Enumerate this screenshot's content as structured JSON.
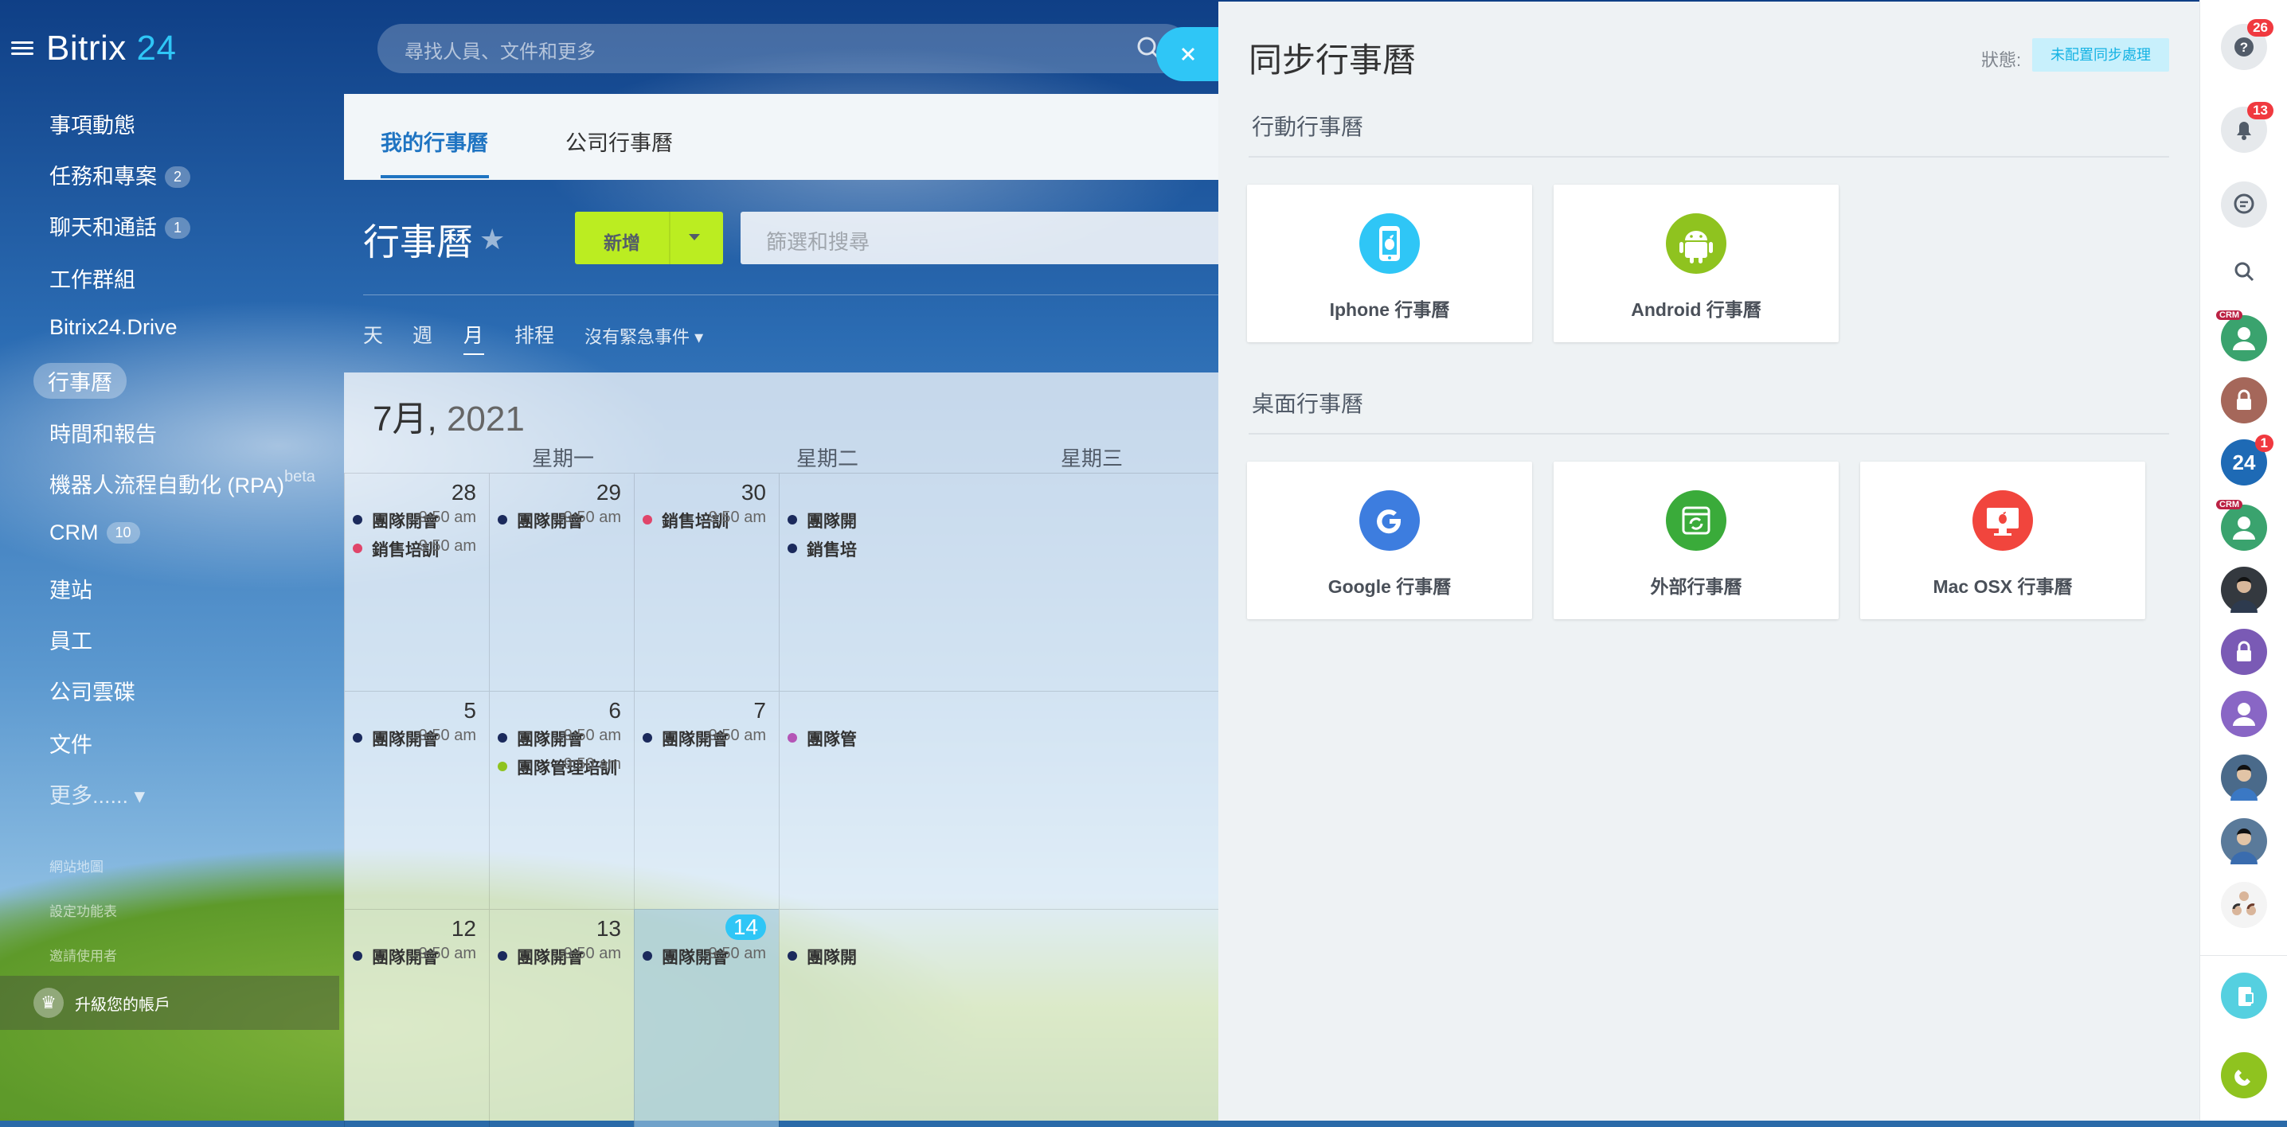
{
  "sidebar": {
    "logo_text": "Bitrix",
    "logo_num": "24",
    "items": [
      {
        "label": "事項動態"
      },
      {
        "label": "任務和專案",
        "badge": "2"
      },
      {
        "label": "聊天和通話",
        "badge": "1"
      },
      {
        "label": "工作群組"
      },
      {
        "label": "Bitrix24.Drive"
      },
      {
        "label": "行事曆",
        "active": true
      },
      {
        "label": "時間和報告"
      },
      {
        "label": "機器人流程自動化 (RPA)",
        "sup": "beta"
      },
      {
        "label": "CRM",
        "badge": "10"
      },
      {
        "label": "建站"
      },
      {
        "label": "員工"
      },
      {
        "label": "公司雲碟"
      },
      {
        "label": "文件"
      },
      {
        "label": "更多...... ▾"
      }
    ],
    "small_items": [
      {
        "label": "網站地圖"
      },
      {
        "label": "設定功能表"
      },
      {
        "label": "邀請使用者"
      }
    ],
    "upgrade_label": "升級您的帳戶"
  },
  "topbar": {
    "search_placeholder": "尋找人員、文件和更多"
  },
  "calendar": {
    "tabs": [
      "我的行事曆",
      "公司行事曆"
    ],
    "title": "行事曆",
    "add_label": "新增",
    "filter_placeholder": "篩選和搜尋",
    "views": [
      "天",
      "週",
      "月",
      "排程",
      "沒有緊急事件 ▾"
    ],
    "month_label": "7月,",
    "year_label": "2021",
    "weekdays": [
      "星期一",
      "星期二",
      "星期三"
    ],
    "weeks": [
      {
        "days": [
          {
            "num": "28",
            "events": [
              {
                "name": "團隊開會",
                "time": "9:50 am",
                "color": "#1b2a5c"
              },
              {
                "name": "銷售培訓",
                "time": "9:50 am",
                "color": "#e0456a"
              }
            ]
          },
          {
            "num": "29",
            "events": [
              {
                "name": "團隊開會",
                "time": "9:50 am",
                "color": "#1b2a5c"
              }
            ]
          },
          {
            "num": "30",
            "events": [
              {
                "name": "銷售培訓",
                "time": "9:50 am",
                "color": "#e0456a"
              }
            ]
          },
          {
            "num": "",
            "events": [
              {
                "name": "團隊開",
                "time": "",
                "color": "#1b2a5c"
              },
              {
                "name": "銷售培",
                "time": "",
                "color": "#1b2a5c"
              }
            ]
          }
        ]
      },
      {
        "days": [
          {
            "num": "5",
            "events": [
              {
                "name": "團隊開會",
                "time": "9:50 am",
                "color": "#1b2a5c"
              }
            ]
          },
          {
            "num": "6",
            "events": [
              {
                "name": "團隊開會",
                "time": "9:50 am",
                "color": "#1b2a5c"
              },
              {
                "name": "團隊管理培訓",
                "time": "9:50 am",
                "color": "#8fc31f"
              }
            ]
          },
          {
            "num": "7",
            "events": [
              {
                "name": "團隊開會",
                "time": "9:50 am",
                "color": "#1b2a5c"
              }
            ]
          },
          {
            "num": "",
            "events": [
              {
                "name": "團隊管",
                "time": "",
                "color": "#b455b6"
              }
            ]
          }
        ]
      },
      {
        "days": [
          {
            "num": "12",
            "events": [
              {
                "name": "團隊開會",
                "time": "9:50 am",
                "color": "#1b2a5c"
              }
            ]
          },
          {
            "num": "13",
            "events": [
              {
                "name": "團隊開會",
                "time": "9:50 am",
                "color": "#1b2a5c"
              }
            ]
          },
          {
            "num": "14",
            "today": true,
            "events": [
              {
                "name": "團隊開會",
                "time": "9:50 am",
                "color": "#1b2a5c"
              }
            ]
          },
          {
            "num": "",
            "events": [
              {
                "name": "團隊開",
                "time": "",
                "color": "#1b2a5c"
              }
            ]
          }
        ]
      }
    ]
  },
  "slider": {
    "title": "同步行事曆",
    "status_label": "狀態:",
    "status_value": "未配置同步處理",
    "mobile_section": "行動行事曆",
    "desktop_section": "桌面行事曆",
    "mobile_cards": [
      {
        "label": "Iphone 行事曆",
        "icon": "apple-phone-icon",
        "color": "#2fc6f6"
      },
      {
        "label": "Android 行事曆",
        "icon": "android-icon",
        "color": "#8fc31f"
      }
    ],
    "desktop_cards": [
      {
        "label": "Google 行事曆",
        "icon": "google-icon",
        "color": "#3d7ddf"
      },
      {
        "label": "外部行事曆",
        "icon": "sync-calendar-icon",
        "color": "#3aab3a"
      },
      {
        "label": "Mac OSX 行事曆",
        "icon": "mac-icon",
        "color": "#f1453d"
      }
    ]
  },
  "rightbar": {
    "help_badge": "26",
    "notif_badge": "13",
    "b24_badge": "1",
    "b24_label": "24",
    "crm_tag": "CRM"
  }
}
